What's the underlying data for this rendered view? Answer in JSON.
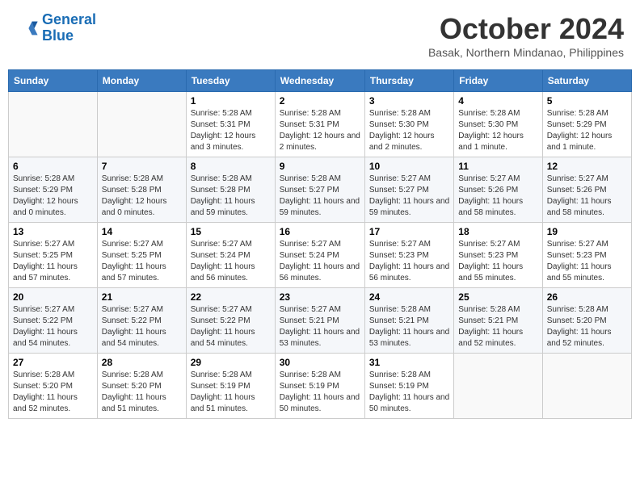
{
  "header": {
    "logo_line1": "General",
    "logo_line2": "Blue",
    "month": "October 2024",
    "location": "Basak, Northern Mindanao, Philippines"
  },
  "days_of_week": [
    "Sunday",
    "Monday",
    "Tuesday",
    "Wednesday",
    "Thursday",
    "Friday",
    "Saturday"
  ],
  "weeks": [
    [
      {
        "day": "",
        "sunrise": "",
        "sunset": "",
        "daylight": ""
      },
      {
        "day": "",
        "sunrise": "",
        "sunset": "",
        "daylight": ""
      },
      {
        "day": "1",
        "sunrise": "Sunrise: 5:28 AM",
        "sunset": "Sunset: 5:31 PM",
        "daylight": "Daylight: 12 hours and 3 minutes."
      },
      {
        "day": "2",
        "sunrise": "Sunrise: 5:28 AM",
        "sunset": "Sunset: 5:31 PM",
        "daylight": "Daylight: 12 hours and 2 minutes."
      },
      {
        "day": "3",
        "sunrise": "Sunrise: 5:28 AM",
        "sunset": "Sunset: 5:30 PM",
        "daylight": "Daylight: 12 hours and 2 minutes."
      },
      {
        "day": "4",
        "sunrise": "Sunrise: 5:28 AM",
        "sunset": "Sunset: 5:30 PM",
        "daylight": "Daylight: 12 hours and 1 minute."
      },
      {
        "day": "5",
        "sunrise": "Sunrise: 5:28 AM",
        "sunset": "Sunset: 5:29 PM",
        "daylight": "Daylight: 12 hours and 1 minute."
      }
    ],
    [
      {
        "day": "6",
        "sunrise": "Sunrise: 5:28 AM",
        "sunset": "Sunset: 5:29 PM",
        "daylight": "Daylight: 12 hours and 0 minutes."
      },
      {
        "day": "7",
        "sunrise": "Sunrise: 5:28 AM",
        "sunset": "Sunset: 5:28 PM",
        "daylight": "Daylight: 12 hours and 0 minutes."
      },
      {
        "day": "8",
        "sunrise": "Sunrise: 5:28 AM",
        "sunset": "Sunset: 5:28 PM",
        "daylight": "Daylight: 11 hours and 59 minutes."
      },
      {
        "day": "9",
        "sunrise": "Sunrise: 5:28 AM",
        "sunset": "Sunset: 5:27 PM",
        "daylight": "Daylight: 11 hours and 59 minutes."
      },
      {
        "day": "10",
        "sunrise": "Sunrise: 5:27 AM",
        "sunset": "Sunset: 5:27 PM",
        "daylight": "Daylight: 11 hours and 59 minutes."
      },
      {
        "day": "11",
        "sunrise": "Sunrise: 5:27 AM",
        "sunset": "Sunset: 5:26 PM",
        "daylight": "Daylight: 11 hours and 58 minutes."
      },
      {
        "day": "12",
        "sunrise": "Sunrise: 5:27 AM",
        "sunset": "Sunset: 5:26 PM",
        "daylight": "Daylight: 11 hours and 58 minutes."
      }
    ],
    [
      {
        "day": "13",
        "sunrise": "Sunrise: 5:27 AM",
        "sunset": "Sunset: 5:25 PM",
        "daylight": "Daylight: 11 hours and 57 minutes."
      },
      {
        "day": "14",
        "sunrise": "Sunrise: 5:27 AM",
        "sunset": "Sunset: 5:25 PM",
        "daylight": "Daylight: 11 hours and 57 minutes."
      },
      {
        "day": "15",
        "sunrise": "Sunrise: 5:27 AM",
        "sunset": "Sunset: 5:24 PM",
        "daylight": "Daylight: 11 hours and 56 minutes."
      },
      {
        "day": "16",
        "sunrise": "Sunrise: 5:27 AM",
        "sunset": "Sunset: 5:24 PM",
        "daylight": "Daylight: 11 hours and 56 minutes."
      },
      {
        "day": "17",
        "sunrise": "Sunrise: 5:27 AM",
        "sunset": "Sunset: 5:23 PM",
        "daylight": "Daylight: 11 hours and 56 minutes."
      },
      {
        "day": "18",
        "sunrise": "Sunrise: 5:27 AM",
        "sunset": "Sunset: 5:23 PM",
        "daylight": "Daylight: 11 hours and 55 minutes."
      },
      {
        "day": "19",
        "sunrise": "Sunrise: 5:27 AM",
        "sunset": "Sunset: 5:23 PM",
        "daylight": "Daylight: 11 hours and 55 minutes."
      }
    ],
    [
      {
        "day": "20",
        "sunrise": "Sunrise: 5:27 AM",
        "sunset": "Sunset: 5:22 PM",
        "daylight": "Daylight: 11 hours and 54 minutes."
      },
      {
        "day": "21",
        "sunrise": "Sunrise: 5:27 AM",
        "sunset": "Sunset: 5:22 PM",
        "daylight": "Daylight: 11 hours and 54 minutes."
      },
      {
        "day": "22",
        "sunrise": "Sunrise: 5:27 AM",
        "sunset": "Sunset: 5:22 PM",
        "daylight": "Daylight: 11 hours and 54 minutes."
      },
      {
        "day": "23",
        "sunrise": "Sunrise: 5:27 AM",
        "sunset": "Sunset: 5:21 PM",
        "daylight": "Daylight: 11 hours and 53 minutes."
      },
      {
        "day": "24",
        "sunrise": "Sunrise: 5:28 AM",
        "sunset": "Sunset: 5:21 PM",
        "daylight": "Daylight: 11 hours and 53 minutes."
      },
      {
        "day": "25",
        "sunrise": "Sunrise: 5:28 AM",
        "sunset": "Sunset: 5:21 PM",
        "daylight": "Daylight: 11 hours and 52 minutes."
      },
      {
        "day": "26",
        "sunrise": "Sunrise: 5:28 AM",
        "sunset": "Sunset: 5:20 PM",
        "daylight": "Daylight: 11 hours and 52 minutes."
      }
    ],
    [
      {
        "day": "27",
        "sunrise": "Sunrise: 5:28 AM",
        "sunset": "Sunset: 5:20 PM",
        "daylight": "Daylight: 11 hours and 52 minutes."
      },
      {
        "day": "28",
        "sunrise": "Sunrise: 5:28 AM",
        "sunset": "Sunset: 5:20 PM",
        "daylight": "Daylight: 11 hours and 51 minutes."
      },
      {
        "day": "29",
        "sunrise": "Sunrise: 5:28 AM",
        "sunset": "Sunset: 5:19 PM",
        "daylight": "Daylight: 11 hours and 51 minutes."
      },
      {
        "day": "30",
        "sunrise": "Sunrise: 5:28 AM",
        "sunset": "Sunset: 5:19 PM",
        "daylight": "Daylight: 11 hours and 50 minutes."
      },
      {
        "day": "31",
        "sunrise": "Sunrise: 5:28 AM",
        "sunset": "Sunset: 5:19 PM",
        "daylight": "Daylight: 11 hours and 50 minutes."
      },
      {
        "day": "",
        "sunrise": "",
        "sunset": "",
        "daylight": ""
      },
      {
        "day": "",
        "sunrise": "",
        "sunset": "",
        "daylight": ""
      }
    ]
  ]
}
